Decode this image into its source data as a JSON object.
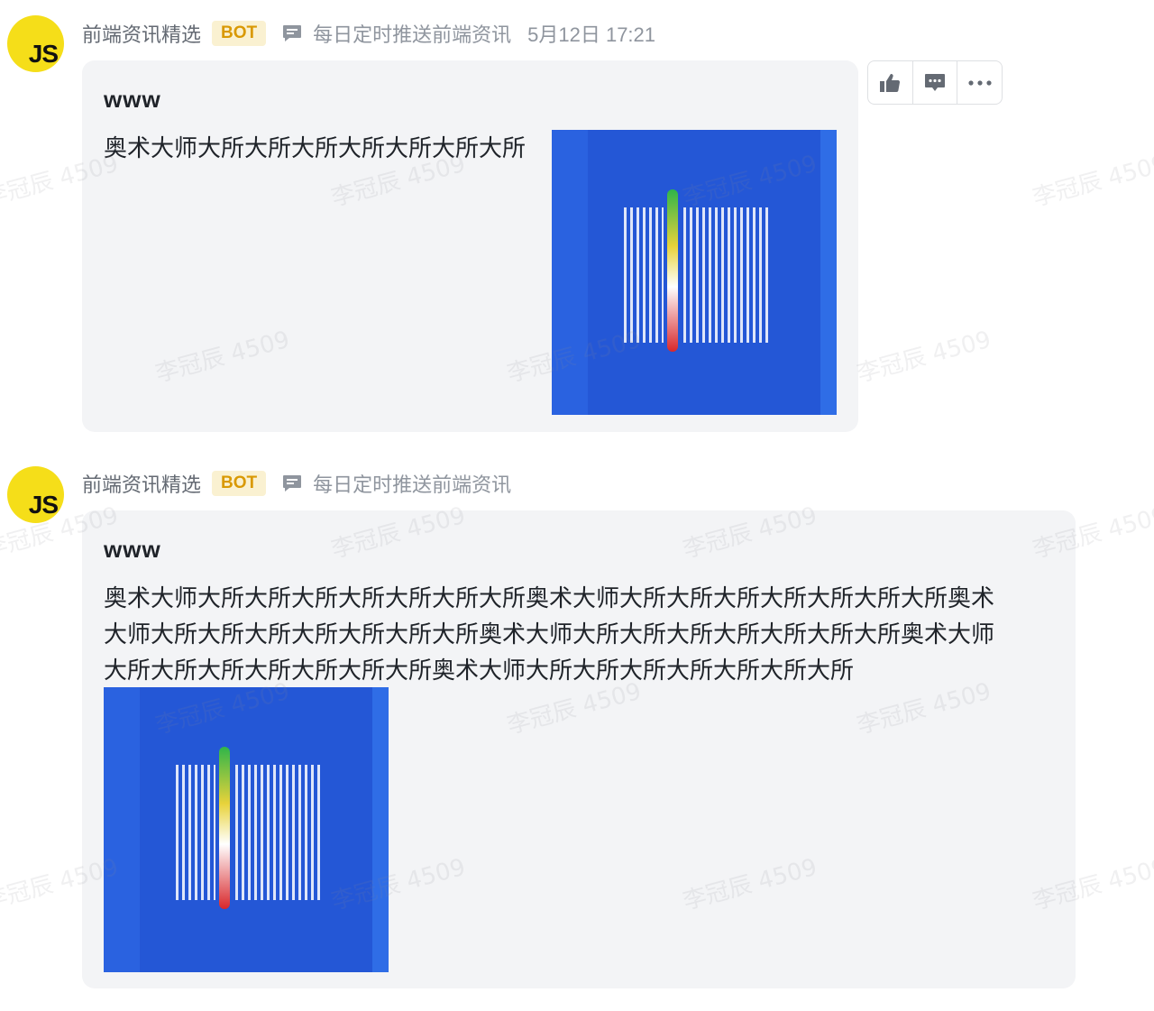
{
  "messages": [
    {
      "sender": "前端资讯精选",
      "badge": "BOT",
      "description": "每日定时推送前端资讯",
      "time": "5月12日 17:21",
      "avatar_text": "JS",
      "title": "www",
      "body": "奥术大师大所大所大所大所大所大所大所"
    },
    {
      "sender": "前端资讯精选",
      "badge": "BOT",
      "description": "每日定时推送前端资讯",
      "avatar_text": "JS",
      "title": "www",
      "body_lines": [
        "奥术大师大所大所大所大所大所大所大所奥术大师大所大所大所大所大所大所大所奥术",
        "大师大所大所大所大所大所大所大所奥术大师大所大所大所大所大所大所大所奥术大师",
        "大所大所大所大所大所大所大所奥术大师大所大所大所大所大所大所大所"
      ]
    }
  ],
  "toolbar": {
    "icons": [
      "thumbs-up-icon",
      "reply-icon",
      "more-icon"
    ]
  },
  "watermark": "李冠辰 4509",
  "colors": {
    "avatar": "#f5de19",
    "bubble": "#f3f4f6",
    "badge_bg": "#faf1d1",
    "badge_text": "#d99904",
    "image_bg": "#2457d6"
  }
}
